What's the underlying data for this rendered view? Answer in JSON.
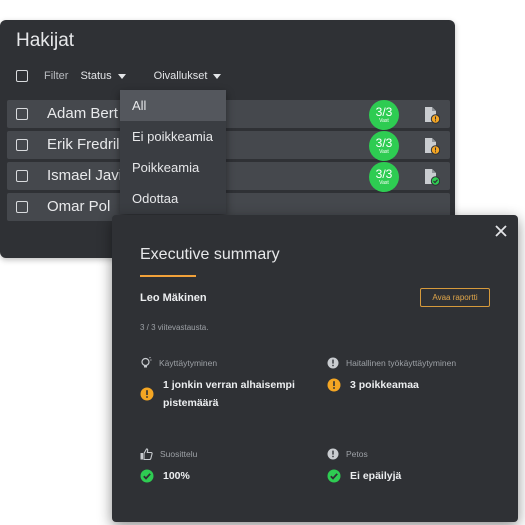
{
  "panel": {
    "title": "Hakijat",
    "filter_label": "Filter",
    "status_label": "Status",
    "oivallukset_label": "Oivallukset"
  },
  "applicants": [
    {
      "name": "Adam Bert",
      "score": "3/3",
      "score_sub": "Vast",
      "doc_status": "warning"
    },
    {
      "name": "Erik Fredril",
      "score": "3/3",
      "score_sub": "Vast",
      "doc_status": "warning"
    },
    {
      "name": "Ismael Javi",
      "score": "3/3",
      "score_sub": "Vast",
      "doc_status": "ok"
    },
    {
      "name": "Omar Pol",
      "score": "",
      "score_sub": "",
      "doc_status": ""
    }
  ],
  "menu": {
    "items": [
      "All",
      "Ei poikkeamia",
      "Poikkeamia",
      "Odottaa"
    ],
    "selected": "All"
  },
  "summary": {
    "title": "Executive summary",
    "candidate": "Leo Mäkinen",
    "report_button": "Avaa raportti",
    "references": "3 / 3 viitevastausta.",
    "behaviour": {
      "label": "Käyttäytyminen",
      "value_line1": "1 jonkin verran alhaisempi",
      "value_line2": "pistemäärä"
    },
    "harmful": {
      "label": "Haitallinen työkäyttäytyminen",
      "value": "3 poikkeamaa"
    },
    "recommendation": {
      "label": "Suosittelu",
      "value": "100%"
    },
    "fraud": {
      "label": "Petos",
      "value": "Ei epäilyjä"
    }
  },
  "colors": {
    "accent_orange": "#f2a23a",
    "success_green": "#2ecc52",
    "warning_yellow": "#f5a623",
    "panel_bg": "#2f3135",
    "row_bg": "#45484d"
  },
  "icons": {
    "close": "close-icon",
    "document": "document-icon",
    "warning": "warning-icon",
    "check": "check-icon",
    "lightbulb": "lightbulb-icon",
    "info": "info-icon",
    "thumbs_up": "thumbs-up-icon"
  }
}
